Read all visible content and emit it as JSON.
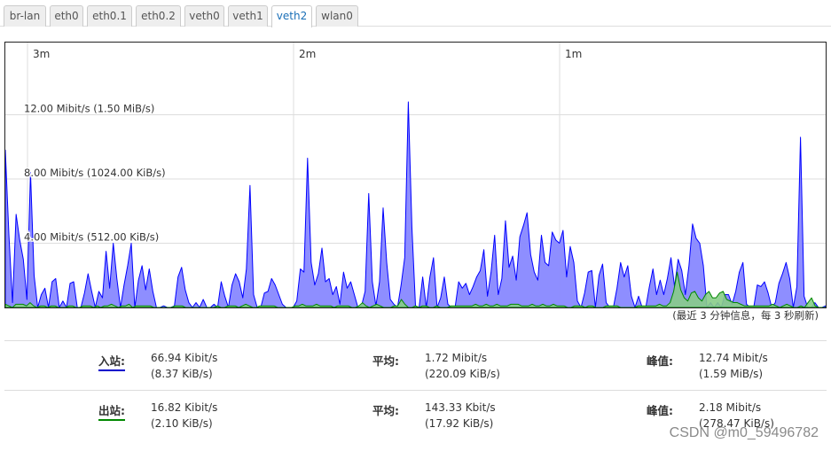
{
  "tabs": [
    {
      "label": "br-lan",
      "active": false
    },
    {
      "label": "eth0",
      "active": false
    },
    {
      "label": "eth0.1",
      "active": false
    },
    {
      "label": "eth0.2",
      "active": false
    },
    {
      "label": "veth0",
      "active": false
    },
    {
      "label": "veth1",
      "active": false
    },
    {
      "label": "veth2",
      "active": true
    },
    {
      "label": "wlan0",
      "active": false
    }
  ],
  "caption": "(最近 3 分钟信息，每 3 秒刷新)",
  "stats": {
    "inbound": {
      "label": "入站:",
      "current": "66.94 Kibit/s",
      "current_bytes": "(8.37 KiB/s)",
      "avg_label": "平均:",
      "avg": "1.72 Mibit/s",
      "avg_bytes": "(220.09 KiB/s)",
      "peak_label": "峰值:",
      "peak": "12.74 Mibit/s",
      "peak_bytes": "(1.59 MiB/s)"
    },
    "outbound": {
      "label": "出站:",
      "current": "16.82 Kibit/s",
      "current_bytes": "(2.10 KiB/s)",
      "avg_label": "平均:",
      "avg": "143.33 Kbit/s",
      "avg_bytes": "(17.92 KiB/s)",
      "peak_label": "峰值:",
      "peak": "2.18 Mibit/s",
      "peak_bytes": "(278.47 KiB/s)"
    }
  },
  "watermark": "CSDN @m0_59496782",
  "colors": {
    "rx_line": "#0000ff",
    "rx_fill": "#8888ff",
    "tx_line": "#008800",
    "tx_fill": "#88cc88",
    "grid": "#dddddd"
  },
  "chart_data": {
    "type": "area",
    "x_ticks": [
      "3m",
      "2m",
      "1m"
    ],
    "y_ticks": [
      {
        "value": 4.0,
        "label": "4.00 Mibit/s (512.00 KiB/s)"
      },
      {
        "value": 8.0,
        "label": "8.00 Mibit/s (1024.00 KiB/s)"
      },
      {
        "value": 12.0,
        "label": "12.00 Mibit/s (1.50 MiB/s)"
      }
    ],
    "ylim": [
      0,
      16.5
    ],
    "unit": "Mibit/s",
    "series": [
      {
        "name": "入站",
        "values": [
          9.8,
          4.5,
          0.3,
          5.8,
          4.2,
          3.0,
          0.5,
          8.4,
          2.0,
          0,
          0.8,
          1.2,
          0,
          1.6,
          1.8,
          0,
          0.4,
          0,
          1.5,
          1.6,
          0,
          0,
          0.9,
          2.1,
          1.0,
          0,
          1.0,
          0.6,
          3.5,
          1.2,
          4.0,
          1.8,
          0,
          1.4,
          2.6,
          4.0,
          0,
          1.7,
          2.6,
          1.1,
          2.4,
          1.0,
          0,
          0,
          0.1,
          0,
          0,
          0.1,
          1.9,
          2.5,
          1.1,
          0.3,
          0,
          0.3,
          0,
          0.5,
          0,
          0,
          0.2,
          0,
          1.6,
          0.7,
          0,
          1.4,
          2.1,
          1.6,
          0.6,
          2.4,
          7.6,
          0.8,
          0,
          0,
          0.9,
          1.0,
          1.8,
          1.4,
          0.8,
          0.2,
          0,
          0,
          0,
          0.4,
          2.4,
          2.2,
          9.3,
          2.8,
          1.4,
          2.1,
          3.7,
          1.6,
          1.8,
          0.8,
          1.3,
          0.2,
          2.2,
          1.2,
          1.6,
          0.8,
          0,
          0.1,
          1.0,
          7.1,
          1.6,
          0.1,
          1.6,
          6.2,
          2.8,
          0.5,
          0.2,
          0,
          1.4,
          3.1,
          12.8,
          5.0,
          0.1,
          0,
          1.9,
          0,
          1.9,
          3.1,
          0,
          0.6,
          1.9,
          0.2,
          0,
          0,
          1.6,
          1.2,
          1.5,
          0.8,
          1.3,
          1.9,
          2.3,
          3.6,
          0.7,
          2.2,
          4.5,
          0.8,
          1.8,
          5.4,
          2.5,
          3.2,
          1.7,
          4.4,
          5.1,
          5.9,
          3.3,
          2.2,
          1.7,
          4.5,
          2.8,
          2.6,
          4.7,
          4.2,
          4.0,
          4.8,
          1.9,
          3.8,
          2.8,
          0.4,
          0,
          0.9,
          2.2,
          2.3,
          0,
          2.0,
          2.7,
          0.3,
          0,
          0,
          1.2,
          2.8,
          1.9,
          2.6,
          0.7,
          0,
          0.7,
          0,
          0,
          1.3,
          2.4,
          0.8,
          1.7,
          0.8,
          1.8,
          3.1,
          1.3,
          3.0,
          2.3,
          0.8,
          2.6,
          5.2,
          4.3,
          4.0,
          2.6,
          0,
          0.3,
          0,
          0.3,
          0,
          0.8,
          0.8,
          0.2,
          1.0,
          2.2,
          2.8,
          0.2,
          0,
          0,
          1.4,
          1.3,
          1.6,
          0.9,
          0,
          0.3,
          1.5,
          2.1,
          2.8,
          1.8,
          0,
          1.3,
          10.6,
          0.7,
          0,
          0,
          0.3,
          0,
          0,
          0.1
        ]
      },
      {
        "name": "出站",
        "values": [
          0.2,
          0.1,
          0,
          0.2,
          0.2,
          0.2,
          0.1,
          0.3,
          0.1,
          0,
          0.1,
          0.1,
          0,
          0.1,
          0.1,
          0,
          0,
          0,
          0.1,
          0.1,
          0,
          0,
          0.1,
          0.1,
          0.1,
          0,
          0.1,
          0,
          0.1,
          0.1,
          0.2,
          0.1,
          0,
          0.1,
          0.1,
          0.2,
          0,
          0.1,
          0.1,
          0.1,
          0.1,
          0.1,
          0,
          0,
          0,
          0,
          0,
          0,
          0.1,
          0.1,
          0.1,
          0,
          0,
          0,
          0,
          0,
          0,
          0,
          0,
          0,
          0.1,
          0,
          0,
          0.1,
          0.1,
          0.1,
          0,
          0.1,
          0.2,
          0.1,
          0,
          0,
          0.1,
          0.1,
          0.1,
          0.1,
          0.1,
          0,
          0,
          0,
          0,
          0,
          0.1,
          0.1,
          0.2,
          0.1,
          0.1,
          0.1,
          0.2,
          0.1,
          0.1,
          0.1,
          0.1,
          0,
          0.1,
          0.1,
          0.1,
          0.1,
          0,
          0,
          0.1,
          0.3,
          0.1,
          0,
          0.1,
          0.2,
          0.1,
          0,
          0,
          0,
          0.1,
          0.1,
          0.5,
          0.2,
          0,
          0,
          0.1,
          0,
          0.1,
          0.1,
          0,
          0,
          0.1,
          0,
          0,
          0,
          0.1,
          0.1,
          0.1,
          0.1,
          0.1,
          0.1,
          0.1,
          0.2,
          0.1,
          0.1,
          0.2,
          0.1,
          0.1,
          0.2,
          0.1,
          0.1,
          0.1,
          0.2,
          0.2,
          0.2,
          0.1,
          0.1,
          0.1,
          0.2,
          0.1,
          0.1,
          0.2,
          0.1,
          0.1,
          0.2,
          0.1,
          0.1,
          0.1,
          0,
          0,
          0.1,
          0.1,
          0.1,
          0,
          0.1,
          0.1,
          0,
          0,
          0,
          0.1,
          0.1,
          0.1,
          0.1,
          0,
          0,
          0,
          0,
          0,
          0.1,
          0.1,
          0.1,
          0.1,
          0.1,
          0.1,
          0.2,
          0.1,
          0.1,
          0.3,
          1.0,
          2.2,
          1.1,
          0.6,
          0.4,
          0.9,
          1.0,
          0.6,
          0.4,
          0.8,
          1.0,
          0.6,
          0.6,
          0.9,
          1.0,
          0.5,
          0.4,
          0.3,
          0.3,
          0.2,
          0.1,
          0.1,
          0.1,
          0.1,
          0.1,
          0.1,
          0.1,
          0.1,
          0.2,
          0.1,
          0,
          0.1,
          0.2,
          0.1,
          0,
          0,
          0.1,
          0,
          0.3,
          0.6,
          0.1,
          0,
          0,
          0
        ]
      }
    ]
  }
}
